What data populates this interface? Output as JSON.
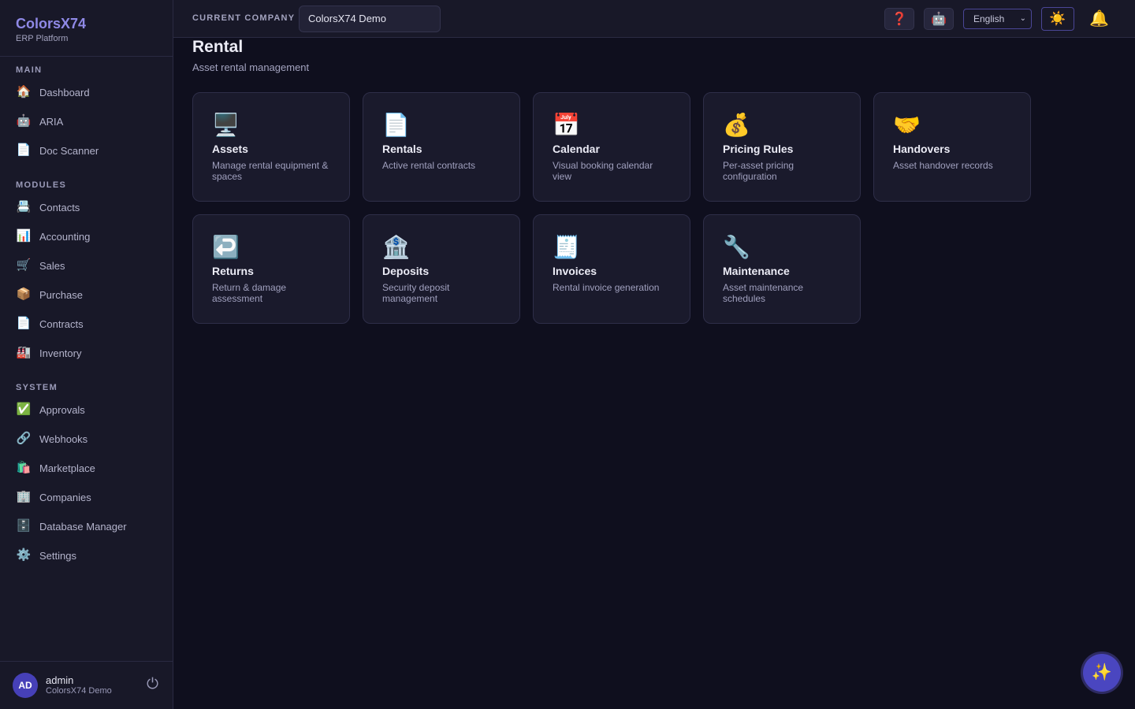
{
  "brand": {
    "name": "ColorsX74",
    "subtitle": "ERP Platform"
  },
  "sidebar": {
    "sections": [
      {
        "title": "MAIN",
        "items": [
          {
            "label": "Dashboard",
            "icon": "🏠"
          },
          {
            "label": "ARIA",
            "icon": "🤖"
          },
          {
            "label": "Doc Scanner",
            "icon": "📄"
          }
        ]
      },
      {
        "title": "MODULES",
        "items": [
          {
            "label": "Contacts",
            "icon": "📇"
          },
          {
            "label": "Accounting",
            "icon": "📊"
          },
          {
            "label": "Sales",
            "icon": "🛒"
          },
          {
            "label": "Purchase",
            "icon": "📦"
          },
          {
            "label": "Contracts",
            "icon": "📄"
          },
          {
            "label": "Inventory",
            "icon": "🏭"
          }
        ]
      },
      {
        "title": "SYSTEM",
        "items": [
          {
            "label": "Approvals",
            "icon": "✅"
          },
          {
            "label": "Webhooks",
            "icon": "🔗"
          },
          {
            "label": "Marketplace",
            "icon": "🛍️"
          },
          {
            "label": "Companies",
            "icon": "🏢"
          },
          {
            "label": "Database Manager",
            "icon": "🗄️"
          },
          {
            "label": "Settings",
            "icon": "⚙️"
          }
        ]
      }
    ]
  },
  "user": {
    "initials": "AD",
    "name": "admin",
    "company": "ColorsX74 Demo",
    "logout_icon": "⏻"
  },
  "topbar": {
    "company_label": "CURRENT COMPANY",
    "company_value": "ColorsX74 Demo",
    "help_icon": "❓",
    "bot_icon": "🤖",
    "language": "English",
    "theme_icon": "☀️",
    "bell_icon": "🔔"
  },
  "page": {
    "title": "Rental",
    "subtitle": "Asset rental management"
  },
  "cards": [
    {
      "icon": "🖥️",
      "title": "Assets",
      "desc": "Manage rental equipment & spaces"
    },
    {
      "icon": "📄",
      "title": "Rentals",
      "desc": "Active rental contracts"
    },
    {
      "icon": "📅",
      "title": "Calendar",
      "desc": "Visual booking calendar view"
    },
    {
      "icon": "💰",
      "title": "Pricing Rules",
      "desc": "Per-asset pricing configuration"
    },
    {
      "icon": "🤝",
      "title": "Handovers",
      "desc": "Asset handover records"
    },
    {
      "icon": "↩️",
      "title": "Returns",
      "desc": "Return & damage assessment"
    },
    {
      "icon": "🏦",
      "title": "Deposits",
      "desc": "Security deposit management"
    },
    {
      "icon": "🧾",
      "title": "Invoices",
      "desc": "Rental invoice generation"
    },
    {
      "icon": "🔧",
      "title": "Maintenance",
      "desc": "Asset maintenance schedules"
    }
  ],
  "fab_icon": "✨"
}
